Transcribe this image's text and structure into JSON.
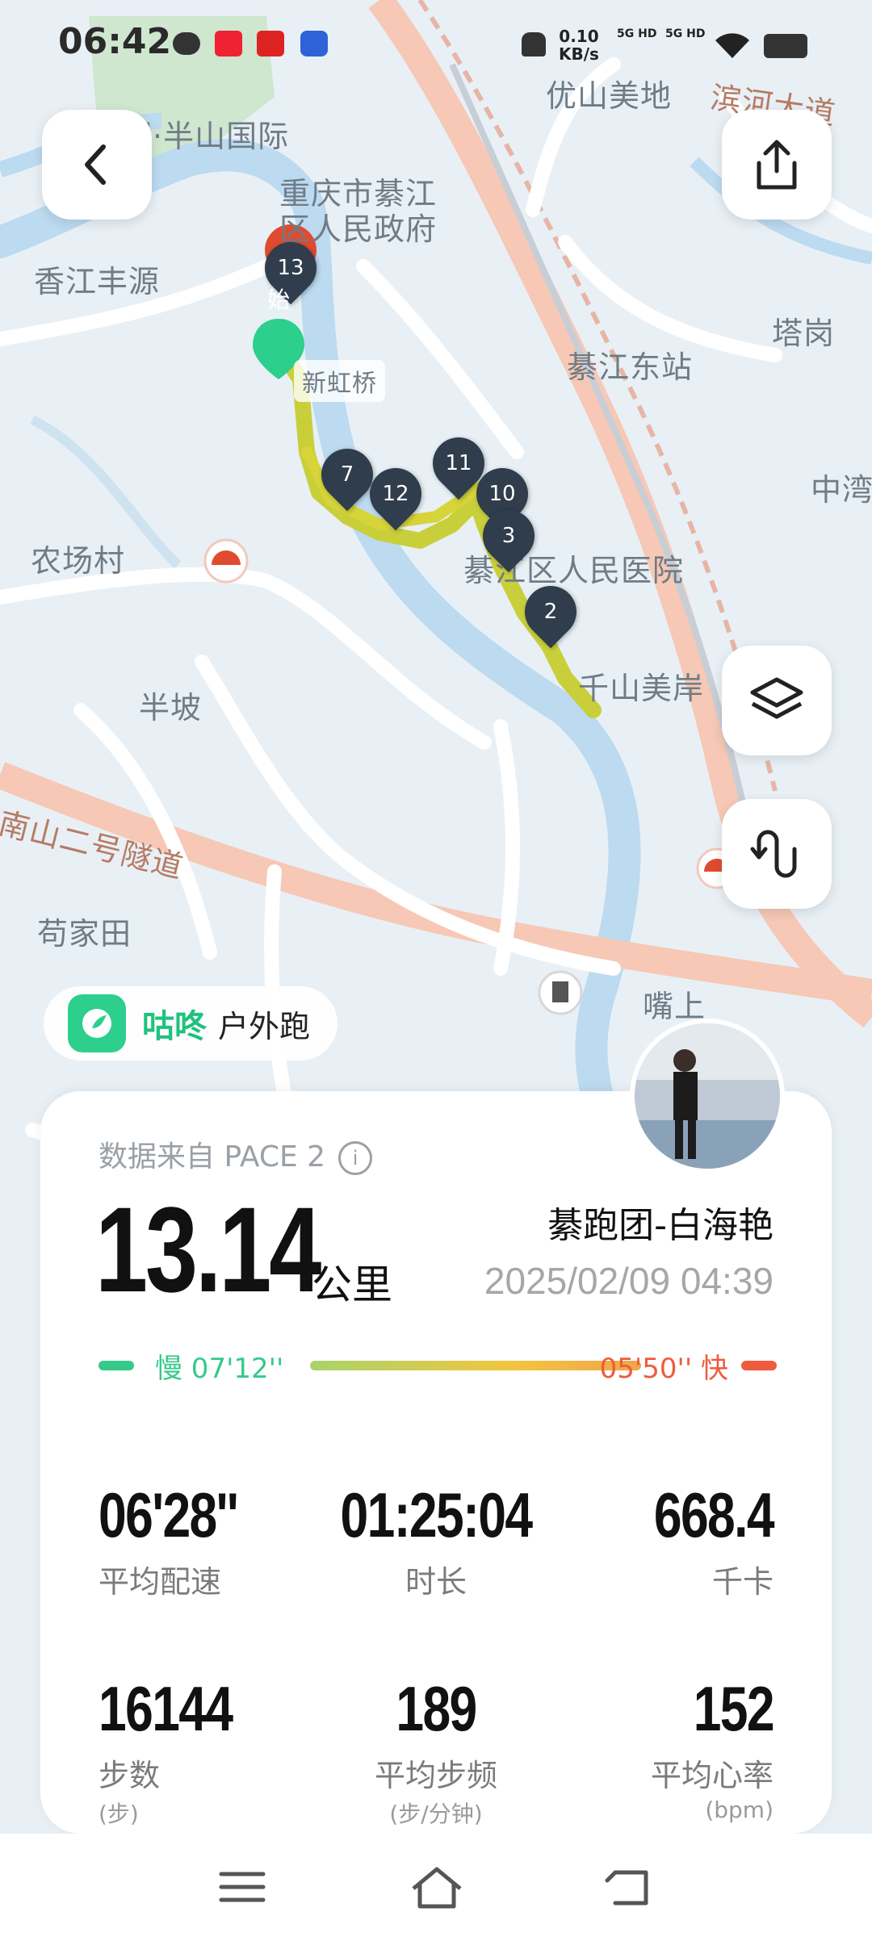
{
  "status_bar": {
    "time": "06:42",
    "net_speed_value": "0.10",
    "net_speed_unit": "KB/s",
    "sim1": "5G HD",
    "sim2": "5G HD"
  },
  "map": {
    "labels": {
      "banshan_intl": "润·半山国际",
      "youshan_meidi": "优山美地",
      "binhe_dadao": "滨河大道",
      "gov": "重庆市綦江区人民政府",
      "xiangjiang": "香江丰源",
      "xinhongqiao": "新虹桥",
      "tagang": "塔岗",
      "qijiang_east": "綦江东站",
      "zhongwan": "中湾",
      "nongchang": "农场村",
      "hospital": "綦江区人民医院",
      "banpo": "半坡",
      "qianshan": "千山美岸",
      "tunnel": "南山二号隧道",
      "goujiatian": "苟家田",
      "zuishang": "嘴上"
    },
    "markers": [
      "13",
      "7",
      "12",
      "11",
      "10",
      "3",
      "2"
    ],
    "start_marker": "始"
  },
  "app": {
    "name": "咕咚",
    "mode": "户外跑"
  },
  "summary": {
    "source": "数据来自 PACE 2",
    "info_icon": "i",
    "distance": "13.14",
    "distance_unit": "公里",
    "runner": "綦跑团-白海艳",
    "datetime": "2025/02/09 04:39",
    "pace_slow": "慢 07'12''",
    "pace_fast": "05'50'' 快"
  },
  "stats": [
    {
      "value": "06'28''",
      "label": "平均配速",
      "unit": ""
    },
    {
      "value": "01:25:04",
      "label": "时长",
      "unit": ""
    },
    {
      "value": "668.4",
      "label": "千卡",
      "unit": ""
    },
    {
      "value": "16144",
      "label": "步数",
      "unit": "(步)"
    },
    {
      "value": "189",
      "label": "平均步频",
      "unit": "(步/分钟)"
    },
    {
      "value": "152",
      "label": "平均心率",
      "unit": "(bpm)"
    }
  ],
  "colors": {
    "route": "#c9cf3a",
    "pin": "#2f3d4c",
    "brand": "#2ccf8c",
    "slow": "#36c98a",
    "fast": "#ee5b3e"
  }
}
